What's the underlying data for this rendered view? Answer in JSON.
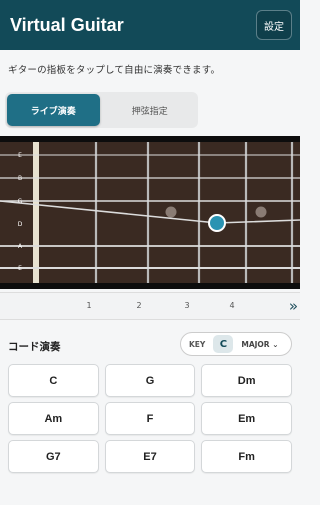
{
  "header": {
    "title": "Virtual Guitar",
    "settings_label": "設定"
  },
  "subtitle": "ギターの指板をタップして自由に演奏できます。",
  "mode_tabs": [
    {
      "label": "ライブ演奏",
      "active": true
    },
    {
      "label": "押弦指定",
      "active": false
    }
  ],
  "fretboard": {
    "string_labels": [
      "E",
      "B",
      "G",
      "D",
      "A",
      "E"
    ],
    "inlay_frets": [
      3,
      5
    ],
    "active_note": {
      "string": "D",
      "fret": 4
    },
    "colors": {
      "wood": "#3b2a22",
      "accent": "#2a93b2"
    }
  },
  "fret_numbers": [
    "1",
    "2",
    "3",
    "4"
  ],
  "next_icon": "double-chevron-right-icon",
  "chords_section": {
    "title": "コード演奏",
    "key_label": "KEY",
    "key_value": "C",
    "mode_value": "MAJOR"
  },
  "chords": [
    "C",
    "G",
    "Dm",
    "Am",
    "F",
    "Em",
    "G7",
    "E7",
    "Fm"
  ]
}
